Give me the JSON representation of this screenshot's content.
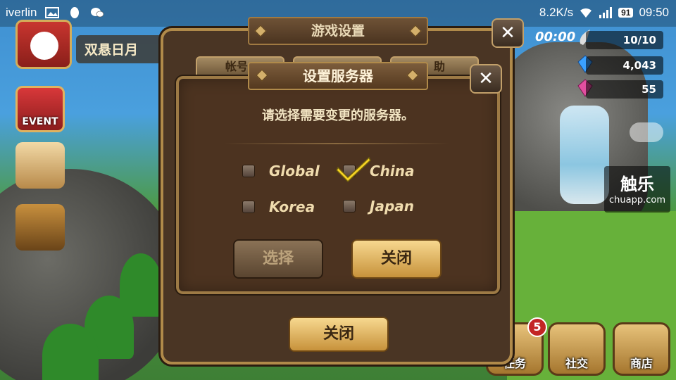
{
  "status_bar": {
    "carrier": "iverlin",
    "speed": "8.2K/s",
    "battery": "91",
    "time": "09:50"
  },
  "hud": {
    "player_name": "双悬日月",
    "timer": "00:00",
    "resources": [
      {
        "icon": "wing-icon",
        "value": "10/10"
      },
      {
        "icon": "crystal-icon",
        "value": "4,043"
      },
      {
        "icon": "gem-icon",
        "value": "55"
      }
    ],
    "event_label": "EVENT",
    "bottom_buttons": [
      {
        "label": "任务",
        "badge": "5"
      },
      {
        "label": "社交"
      },
      {
        "label": "商店"
      }
    ]
  },
  "watermark": {
    "title": "触乐",
    "site": "chuapp.com"
  },
  "outer_dialog": {
    "title": "游戏设置",
    "tabs": [
      "帐号",
      "",
      "助"
    ],
    "close_button": "关闭"
  },
  "server_dialog": {
    "title": "设置服务器",
    "prompt": "请选择需要变更的服务器。",
    "options": [
      {
        "label": "Global",
        "checked": false
      },
      {
        "label": "China",
        "checked": true
      },
      {
        "label": "Korea",
        "checked": false
      },
      {
        "label": "Japan",
        "checked": false
      }
    ],
    "select_button": "选择",
    "close_button": "关闭"
  },
  "colors": {
    "panel": "#4c3320",
    "border": "#9d7a45",
    "gold_button": "#e0b35f",
    "checkmark": "#f4d223"
  }
}
